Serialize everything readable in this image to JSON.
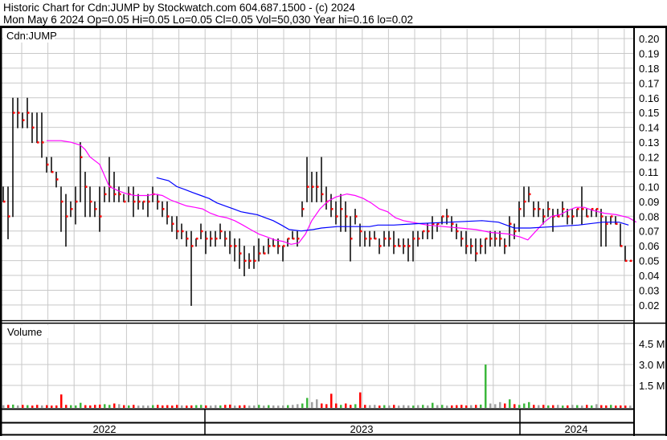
{
  "header": {
    "title": "Historic Chart for Cdn:JUMP by Stockwatch.com 604.687.1500 - (c) 2024",
    "quote_line": "Mon May  6 2024  Op=0.05  Hi=0.05  Lo=0.05  Cl=0.05  Vol=50,030  Year hi=0.16  lo=0.02"
  },
  "chart_data": {
    "type": "bar",
    "subtype": "ohlc-with-volume",
    "symbol_label": "Cdn:JUMP",
    "volume_label": "Volume",
    "price_ylim": [
      0.01,
      0.2
    ],
    "price_ticks": [
      "0.20",
      "0.19",
      "0.18",
      "0.17",
      "0.16",
      "0.15",
      "0.14",
      "0.13",
      "0.12",
      "0.11",
      "0.10",
      "0.09",
      "0.08",
      "0.07",
      "0.06",
      "0.05",
      "0.04",
      "0.03",
      "0.02"
    ],
    "volume_ticks": [
      {
        "label": "4.5 M",
        "value": 4.5
      },
      {
        "label": "3.0 M",
        "value": 3.0
      },
      {
        "label": "1.5 M",
        "value": 1.5
      }
    ],
    "years": [
      "2022",
      "2023",
      "2024"
    ],
    "grid": true,
    "colors": {
      "bar": "#000000",
      "close": "#ff0000",
      "ma_short": "#ff00ff",
      "ma_long": "#0000ff",
      "vol_up": "#3cb83c",
      "vol_down": "#ff0000",
      "vol_flat": "#a0a0a0",
      "grid": "#c8c8c8"
    },
    "ohlc_hlc": [
      [
        0.1,
        0.09,
        0.09
      ],
      [
        0.1,
        0.065,
        0.08
      ],
      [
        0.16,
        0.08,
        0.15
      ],
      [
        0.16,
        0.14,
        0.15
      ],
      [
        0.15,
        0.14,
        0.145
      ],
      [
        0.16,
        0.14,
        0.15
      ],
      [
        0.15,
        0.13,
        0.14
      ],
      [
        0.15,
        0.13,
        0.13
      ],
      [
        0.15,
        0.12,
        0.13
      ],
      [
        0.12,
        0.11,
        0.115
      ],
      [
        0.12,
        0.11,
        0.11
      ],
      [
        0.11,
        0.1,
        0.105
      ],
      [
        0.1,
        0.07,
        0.09
      ],
      [
        0.095,
        0.06,
        0.08
      ],
      [
        0.09,
        0.08,
        0.085
      ],
      [
        0.1,
        0.075,
        0.09
      ],
      [
        0.13,
        0.09,
        0.12
      ],
      [
        0.11,
        0.08,
        0.1
      ],
      [
        0.1,
        0.08,
        0.09
      ],
      [
        0.09,
        0.08,
        0.085
      ],
      [
        0.1,
        0.07,
        0.08
      ],
      [
        0.1,
        0.09,
        0.095
      ],
      [
        0.12,
        0.09,
        0.1
      ],
      [
        0.11,
        0.09,
        0.095
      ],
      [
        0.1,
        0.09,
        0.095
      ],
      [
        0.095,
        0.09,
        0.09
      ],
      [
        0.1,
        0.09,
        0.095
      ],
      [
        0.1,
        0.08,
        0.09
      ],
      [
        0.095,
        0.085,
        0.09
      ],
      [
        0.09,
        0.085,
        0.09
      ],
      [
        0.095,
        0.08,
        0.09
      ],
      [
        0.1,
        0.09,
        0.095
      ],
      [
        0.095,
        0.085,
        0.09
      ],
      [
        0.09,
        0.08,
        0.085
      ],
      [
        0.09,
        0.075,
        0.08
      ],
      [
        0.08,
        0.07,
        0.075
      ],
      [
        0.08,
        0.065,
        0.07
      ],
      [
        0.075,
        0.065,
        0.07
      ],
      [
        0.07,
        0.06,
        0.065
      ],
      [
        0.07,
        0.02,
        0.06
      ],
      [
        0.065,
        0.06,
        0.065
      ],
      [
        0.075,
        0.065,
        0.07
      ],
      [
        0.07,
        0.055,
        0.065
      ],
      [
        0.07,
        0.06,
        0.065
      ],
      [
        0.07,
        0.06,
        0.065
      ],
      [
        0.075,
        0.065,
        0.07
      ],
      [
        0.07,
        0.06,
        0.065
      ],
      [
        0.07,
        0.055,
        0.06
      ],
      [
        0.065,
        0.05,
        0.06
      ],
      [
        0.065,
        0.045,
        0.055
      ],
      [
        0.06,
        0.04,
        0.05
      ],
      [
        0.055,
        0.045,
        0.05
      ],
      [
        0.06,
        0.045,
        0.05
      ],
      [
        0.065,
        0.05,
        0.055
      ],
      [
        0.06,
        0.055,
        0.055
      ],
      [
        0.065,
        0.055,
        0.06
      ],
      [
        0.065,
        0.06,
        0.06
      ],
      [
        0.065,
        0.055,
        0.06
      ],
      [
        0.06,
        0.05,
        0.06
      ],
      [
        0.065,
        0.06,
        0.065
      ],
      [
        0.07,
        0.065,
        0.065
      ],
      [
        0.07,
        0.06,
        0.065
      ],
      [
        0.09,
        0.08,
        0.085
      ],
      [
        0.12,
        0.09,
        0.1
      ],
      [
        0.11,
        0.09,
        0.1
      ],
      [
        0.11,
        0.09,
        0.1
      ],
      [
        0.12,
        0.09,
        0.095
      ],
      [
        0.1,
        0.085,
        0.09
      ],
      [
        0.095,
        0.08,
        0.085
      ],
      [
        0.09,
        0.075,
        0.08
      ],
      [
        0.095,
        0.07,
        0.085
      ],
      [
        0.09,
        0.07,
        0.08
      ],
      [
        0.08,
        0.05,
        0.065
      ],
      [
        0.085,
        0.075,
        0.08
      ],
      [
        0.075,
        0.06,
        0.07
      ],
      [
        0.07,
        0.06,
        0.065
      ],
      [
        0.07,
        0.06,
        0.065
      ],
      [
        0.07,
        0.065,
        0.065
      ],
      [
        0.065,
        0.055,
        0.06
      ],
      [
        0.07,
        0.06,
        0.065
      ],
      [
        0.07,
        0.06,
        0.065
      ],
      [
        0.07,
        0.055,
        0.06
      ],
      [
        0.065,
        0.06,
        0.06
      ],
      [
        0.065,
        0.055,
        0.06
      ],
      [
        0.065,
        0.05,
        0.06
      ],
      [
        0.07,
        0.05,
        0.065
      ],
      [
        0.07,
        0.06,
        0.065
      ],
      [
        0.07,
        0.065,
        0.07
      ],
      [
        0.075,
        0.065,
        0.07
      ],
      [
        0.08,
        0.065,
        0.075
      ],
      [
        0.075,
        0.07,
        0.075
      ],
      [
        0.08,
        0.075,
        0.08
      ],
      [
        0.085,
        0.075,
        0.08
      ],
      [
        0.08,
        0.07,
        0.075
      ],
      [
        0.075,
        0.065,
        0.07
      ],
      [
        0.07,
        0.06,
        0.065
      ],
      [
        0.07,
        0.055,
        0.06
      ],
      [
        0.065,
        0.055,
        0.06
      ],
      [
        0.065,
        0.05,
        0.055
      ],
      [
        0.065,
        0.055,
        0.06
      ],
      [
        0.065,
        0.055,
        0.065
      ],
      [
        0.07,
        0.06,
        0.065
      ],
      [
        0.07,
        0.06,
        0.065
      ],
      [
        0.07,
        0.06,
        0.065
      ],
      [
        0.065,
        0.055,
        0.06
      ],
      [
        0.08,
        0.06,
        0.075
      ],
      [
        0.075,
        0.065,
        0.07
      ],
      [
        0.09,
        0.07,
        0.085
      ],
      [
        0.1,
        0.08,
        0.09
      ],
      [
        0.1,
        0.09,
        0.095
      ],
      [
        0.09,
        0.08,
        0.085
      ],
      [
        0.09,
        0.08,
        0.085
      ],
      [
        0.085,
        0.075,
        0.08
      ],
      [
        0.09,
        0.08,
        0.085
      ],
      [
        0.085,
        0.07,
        0.08
      ],
      [
        0.085,
        0.08,
        0.08
      ],
      [
        0.09,
        0.08,
        0.085
      ],
      [
        0.085,
        0.075,
        0.08
      ],
      [
        0.085,
        0.075,
        0.08
      ],
      [
        0.085,
        0.08,
        0.085
      ],
      [
        0.1,
        0.075,
        0.085
      ],
      [
        0.085,
        0.08,
        0.08
      ],
      [
        0.085,
        0.08,
        0.085
      ],
      [
        0.085,
        0.08,
        0.085
      ],
      [
        0.085,
        0.06,
        0.08
      ],
      [
        0.08,
        0.06,
        0.075
      ],
      [
        0.08,
        0.075,
        0.08
      ],
      [
        0.08,
        0.075,
        0.075
      ],
      [
        0.075,
        0.06,
        0.06
      ],
      [
        0.06,
        0.05,
        0.05
      ],
      [
        0.05,
        0.05,
        0.05
      ]
    ],
    "volume_millions": [
      0.08,
      0.1,
      0.12,
      0.06,
      0.1,
      0.08,
      0.05,
      0.1,
      0.06,
      0.08,
      0.05,
      0.06,
      0.85,
      0.1,
      0.08,
      0.06,
      0.25,
      0.08,
      0.06,
      0.1,
      0.12,
      0.15,
      0.1,
      0.2,
      0.15,
      0.08,
      0.06,
      0.1,
      0.05,
      0.06,
      0.05,
      0.08,
      0.1,
      0.06,
      0.08,
      0.05,
      0.1,
      0.06,
      0.05,
      0.06,
      0.08,
      0.1,
      0.06,
      0.05,
      0.08,
      0.06,
      0.1,
      0.12,
      0.05,
      0.06,
      0.08,
      0.05,
      0.06,
      0.1,
      0.05,
      0.08,
      0.06,
      0.05,
      0.06,
      0.08,
      0.1,
      0.15,
      0.2,
      0.6,
      0.3,
      0.5,
      0.2,
      0.15,
      0.9,
      0.2,
      0.1,
      0.2,
      0.1,
      0.15,
      1.0,
      0.1,
      0.08,
      0.1,
      0.05,
      0.08,
      0.06,
      0.1,
      0.05,
      0.08,
      0.06,
      0.05,
      0.08,
      0.1,
      0.06,
      0.25,
      0.08,
      0.1,
      0.05,
      0.06,
      0.08,
      0.1,
      0.06,
      0.08,
      0.1,
      0.12,
      3.0,
      0.2,
      0.15,
      0.3,
      0.2,
      0.5,
      0.15,
      0.1,
      0.2,
      0.3,
      0.1,
      0.08,
      0.1,
      0.06,
      0.08,
      0.1,
      0.05,
      0.06,
      0.1,
      0.08,
      0.05,
      0.1,
      0.06,
      0.15,
      0.08,
      0.06,
      0.1,
      0.05,
      0.06,
      0.05,
      0.05
    ],
    "ma_short": [
      [
        9,
        0.131
      ],
      [
        12,
        0.131
      ],
      [
        14,
        0.13
      ],
      [
        16,
        0.128
      ],
      [
        17,
        0.125
      ],
      [
        18,
        0.12
      ],
      [
        20,
        0.115
      ],
      [
        22,
        0.1
      ],
      [
        24,
        0.097
      ],
      [
        25.7,
        0.095
      ],
      [
        27.3,
        0.094
      ],
      [
        30,
        0.094
      ],
      [
        31.3,
        0.095
      ],
      [
        33,
        0.094
      ],
      [
        34.7,
        0.091
      ],
      [
        36.3,
        0.089
      ],
      [
        38,
        0.087
      ],
      [
        39.7,
        0.086
      ],
      [
        41.3,
        0.085
      ],
      [
        43,
        0.082
      ],
      [
        44.7,
        0.08
      ],
      [
        46.3,
        0.079
      ],
      [
        48,
        0.077
      ],
      [
        49.7,
        0.074
      ],
      [
        51.3,
        0.071
      ],
      [
        53,
        0.068
      ],
      [
        54.7,
        0.066
      ],
      [
        56.3,
        0.064
      ],
      [
        58,
        0.063
      ],
      [
        59.7,
        0.061
      ],
      [
        61.3,
        0.062
      ],
      [
        62.7,
        0.068
      ],
      [
        64,
        0.077
      ],
      [
        65.7,
        0.085
      ],
      [
        67.3,
        0.09
      ],
      [
        69,
        0.093
      ],
      [
        71.3,
        0.095
      ],
      [
        73,
        0.094
      ],
      [
        74.7,
        0.092
      ],
      [
        76.3,
        0.089
      ],
      [
        78,
        0.085
      ],
      [
        79.7,
        0.083
      ],
      [
        81.3,
        0.079
      ],
      [
        83,
        0.077
      ],
      [
        84.7,
        0.076
      ],
      [
        86.3,
        0.075
      ],
      [
        88,
        0.074
      ],
      [
        91.3,
        0.073
      ],
      [
        94.7,
        0.072
      ],
      [
        98,
        0.071
      ],
      [
        101.3,
        0.069
      ],
      [
        104.7,
        0.068
      ],
      [
        107.2,
        0.066
      ],
      [
        108.8,
        0.064
      ],
      [
        110.5,
        0.07
      ],
      [
        112.2,
        0.076
      ],
      [
        113.8,
        0.08
      ],
      [
        115.5,
        0.081
      ],
      [
        117.2,
        0.084
      ],
      [
        118.8,
        0.086
      ],
      [
        120.5,
        0.086
      ],
      [
        122.2,
        0.084
      ],
      [
        124.7,
        0.082
      ],
      [
        127.2,
        0.081
      ],
      [
        129.7,
        0.079
      ],
      [
        131.3,
        0.076
      ]
    ],
    "ma_long": [
      [
        31.8,
        0.106
      ],
      [
        34.3,
        0.104
      ],
      [
        36,
        0.1
      ],
      [
        37.7,
        0.098
      ],
      [
        39.3,
        0.096
      ],
      [
        41,
        0.094
      ],
      [
        42.7,
        0.092
      ],
      [
        44.3,
        0.089
      ],
      [
        46,
        0.087
      ],
      [
        47.7,
        0.085
      ],
      [
        49.3,
        0.083
      ],
      [
        51,
        0.082
      ],
      [
        52.7,
        0.081
      ],
      [
        54.3,
        0.079
      ],
      [
        56,
        0.077
      ],
      [
        57.7,
        0.074
      ],
      [
        59.3,
        0.071
      ],
      [
        61.8,
        0.07
      ],
      [
        64.3,
        0.071
      ],
      [
        66,
        0.072
      ],
      [
        69.3,
        0.073
      ],
      [
        72.7,
        0.073
      ],
      [
        76,
        0.073
      ],
      [
        77.7,
        0.074
      ],
      [
        81,
        0.074
      ],
      [
        86,
        0.075
      ],
      [
        92.7,
        0.076
      ],
      [
        99.3,
        0.077
      ],
      [
        102.7,
        0.076
      ],
      [
        106,
        0.072
      ],
      [
        109.3,
        0.072
      ],
      [
        114.3,
        0.073
      ],
      [
        119.3,
        0.074
      ],
      [
        124.3,
        0.076
      ],
      [
        127.7,
        0.076
      ],
      [
        129.7,
        0.074
      ]
    ]
  }
}
